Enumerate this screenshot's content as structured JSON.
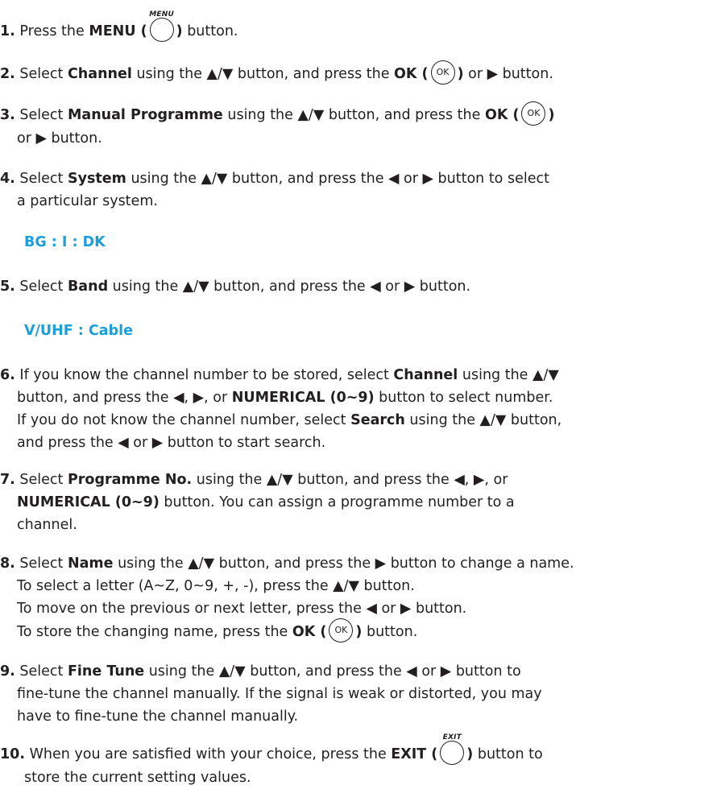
{
  "steps": {
    "s1": {
      "num": "1.",
      "t1": "Press the ",
      "b1": "MENU (",
      "btn_caption": "MENU",
      "b2": ")",
      "t2": " button."
    },
    "s2": {
      "num": "2.",
      "t1": "Select ",
      "b1": "Channel",
      "t2": " using the ▲/▼ button, and press the ",
      "b2": "OK (",
      "btn": "OK",
      "b3": ")",
      "t3": " or ▶ button."
    },
    "s3": {
      "num": "3.",
      "t1": "Select ",
      "b1": "Manual Programme",
      "t2": " using the ▲/▼ button, and press the ",
      "b2": "OK (",
      "btn": "OK",
      "b3": ")",
      "t3": "or ▶ button."
    },
    "s4": {
      "num": "4.",
      "t1": "Select ",
      "b1": "System",
      "t2": " using the ▲/▼ button, and press the ◀ or ▶ button to select",
      "t3": "a particular system."
    },
    "s4_value": "BG : I : DK",
    "s5": {
      "num": "5.",
      "t1": "Select ",
      "b1": "Band",
      "t2": " using the ▲/▼ button, and press the ◀ or ▶ button."
    },
    "s5_value": "V/UHF : Cable",
    "s6": {
      "num": "6.",
      "l1a": "If you know the channel number to be stored, select ",
      "l1b": "Channel",
      "l1c": " using the ▲/▼",
      "l2a": "button, and press the ◀, ▶, or ",
      "l2b": "NUMERICAL (0~9)",
      "l2c": " button to select number.",
      "l3a": "If you do not know the channel number, select ",
      "l3b": "Search",
      "l3c": " using the ▲/▼ button,",
      "l4": "and press the ◀ or ▶ button to start search."
    },
    "s7": {
      "num": "7.",
      "l1a": "Select ",
      "l1b": "Programme No.",
      "l1c": " using the ▲/▼ button, and press the ◀, ▶, or",
      "l2a": "NUMERICAL (0~9)",
      "l2b": " button. You can assign a programme number to a",
      "l3": "channel."
    },
    "s8": {
      "num": "8.",
      "l1a": "Select ",
      "l1b": "Name",
      "l1c": " using the ▲/▼ button, and press the ▶ button to change a name.",
      "l2": "To select a letter (A~Z, 0~9, +, -), press the ▲/▼ button.",
      "l3": "To move on the previous or next letter, press the ◀ or ▶ button.",
      "l4a": "To store the changing name, press the ",
      "l4b": "OK (",
      "btn": "OK",
      "l4c": ")",
      "l4d": " button."
    },
    "s9": {
      "num": "9.",
      "l1a": "Select ",
      "l1b": "Fine Tune",
      "l1c": " using the ▲/▼ button, and press the ◀ or ▶ button to",
      "l2": "fine-tune the channel manually. If the signal is weak or distorted, you may",
      "l3": "have to fine-tune the channel manually."
    },
    "s10": {
      "num": "10.",
      "l1a": "When you are satisfied with your choice, press the ",
      "l1b": "EXIT (",
      "btn_caption": "EXIT",
      "l1c": ")",
      "l1d": " button to",
      "l2": "store the current setting values."
    }
  },
  "colors": {
    "text": "#231f20",
    "value_accent": "#1a9fdb"
  }
}
